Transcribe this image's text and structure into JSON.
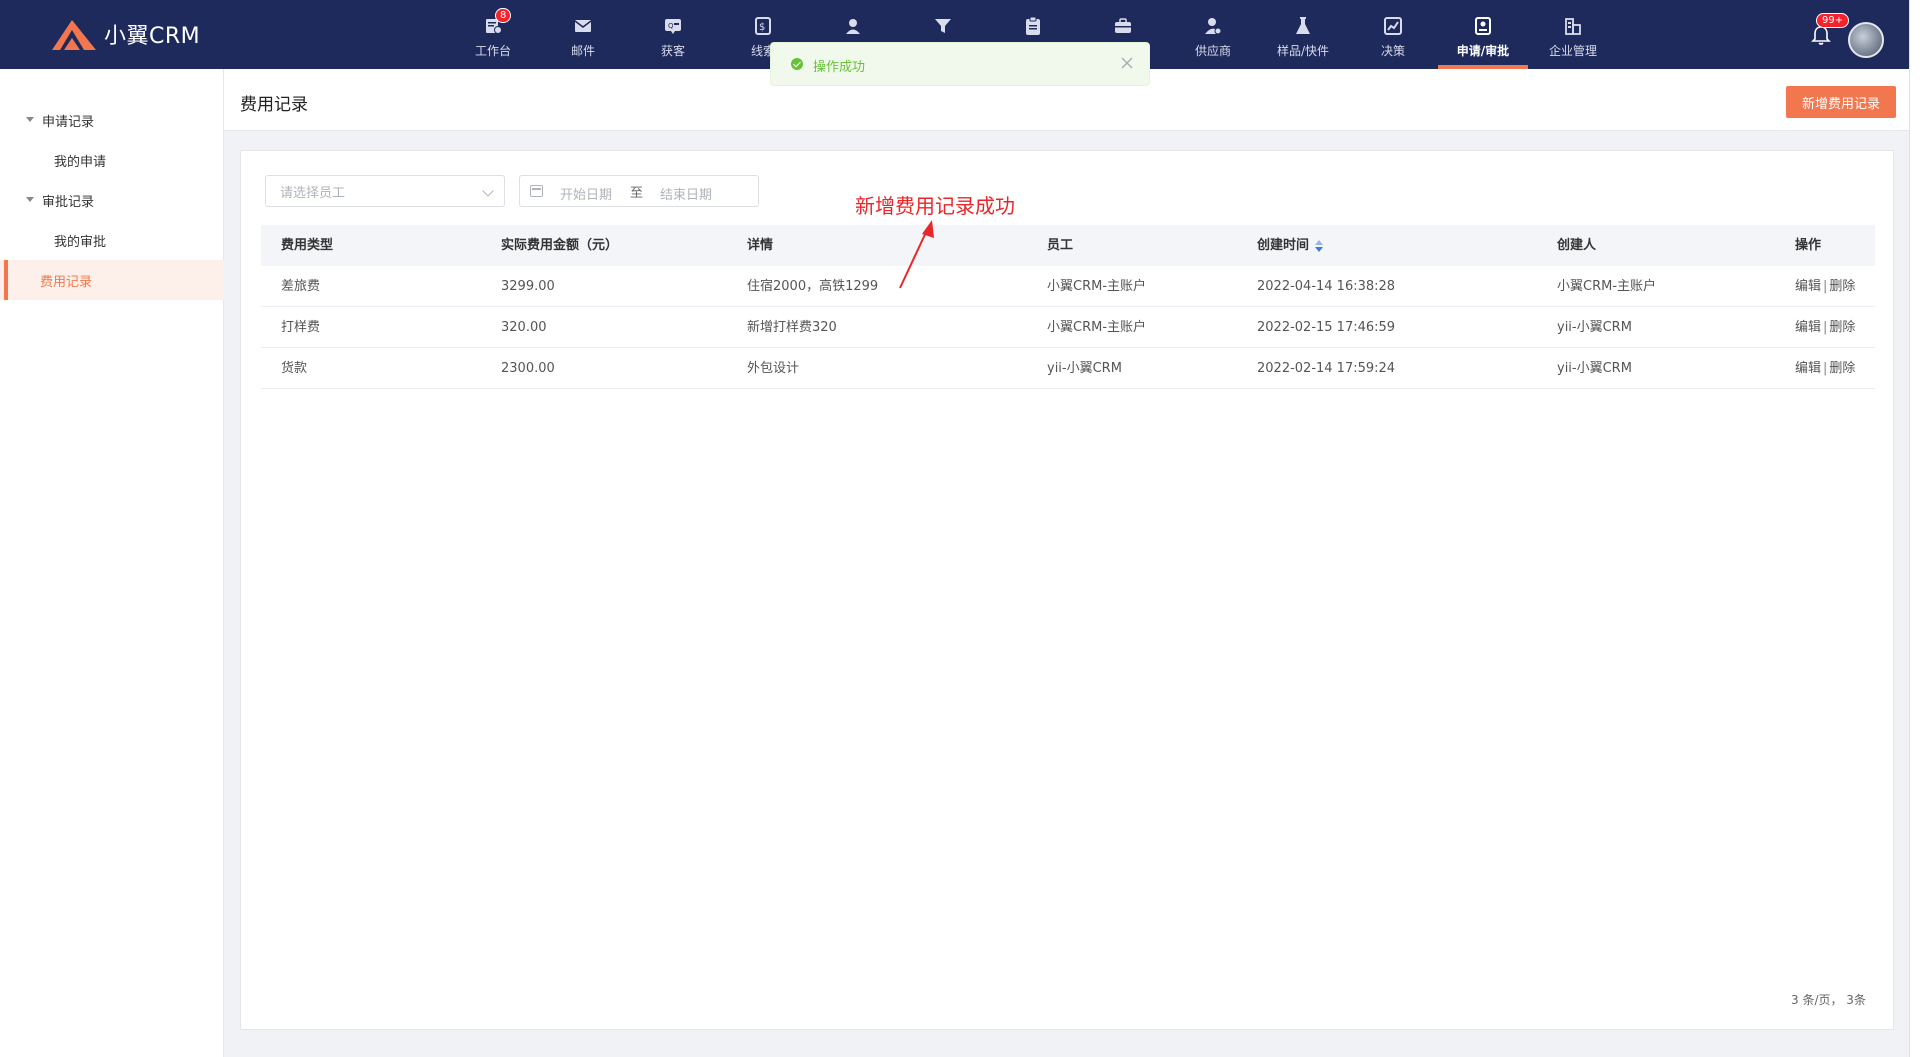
{
  "app": {
    "logo_text": "小翼CRM",
    "brand_color": "#f2774e",
    "nav_bg": "#1e2a5c"
  },
  "nav": {
    "items": [
      {
        "label": "工作台",
        "icon": "workbench-icon",
        "badge": "8"
      },
      {
        "label": "邮件",
        "icon": "mail-icon"
      },
      {
        "label": "获客",
        "icon": "acquire-icon"
      },
      {
        "label": "线索",
        "icon": "clue-icon"
      },
      {
        "label": "",
        "icon": "customer-icon"
      },
      {
        "label": "",
        "icon": "filter-icon"
      },
      {
        "label": "",
        "icon": "clipboard-icon"
      },
      {
        "label": "",
        "icon": "briefcase-icon"
      },
      {
        "label": "供应商",
        "icon": "supplier-icon"
      },
      {
        "label": "样品/快件",
        "icon": "flask-icon"
      },
      {
        "label": "决策",
        "icon": "chart-icon"
      },
      {
        "label": "申请/审批",
        "icon": "approval-icon",
        "active": true
      },
      {
        "label": "企业管理",
        "icon": "company-icon"
      }
    ],
    "notification_badge": "99+"
  },
  "toast": {
    "message": "操作成功",
    "status_color": "#67c23a"
  },
  "sidebar": {
    "groups": [
      {
        "label": "申请记录",
        "children": [
          "我的申请"
        ]
      },
      {
        "label": "审批记录",
        "children": [
          "我的审批"
        ]
      }
    ],
    "active_item": "费用记录"
  },
  "page": {
    "title": "费用记录",
    "add_button": "新增费用记录"
  },
  "filters": {
    "employee_placeholder": "请选择员工",
    "start_date_placeholder": "开始日期",
    "range_separator": "至",
    "end_date_placeholder": "结束日期"
  },
  "table": {
    "headers": [
      "费用类型",
      "实际费用金额（元）",
      "详情",
      "员工",
      "创建时间",
      "创建人",
      "操作"
    ],
    "rows": [
      {
        "type": "差旅费",
        "amount": "3299.00",
        "detail": "住宿2000，高铁1299",
        "employee": "小翼CRM-主账户",
        "created_at": "2022-04-14 16:38:28",
        "creator": "小翼CRM-主账户"
      },
      {
        "type": "打样费",
        "amount": "320.00",
        "detail": "新增打样费320",
        "employee": "小翼CRM-主账户",
        "created_at": "2022-02-15 17:46:59",
        "creator": "yii-小翼CRM"
      },
      {
        "type": "货款",
        "amount": "2300.00",
        "detail": "外包设计",
        "employee": "yii-小翼CRM",
        "created_at": "2022-02-14 17:59:24",
        "creator": "yii-小翼CRM"
      }
    ],
    "action_edit": "编辑",
    "action_sep": "|",
    "action_delete": "删除"
  },
  "pagination": {
    "summary": "3 条/页，  3条"
  },
  "annotation": {
    "text": "新增费用记录成功",
    "color": "#e8272a"
  }
}
